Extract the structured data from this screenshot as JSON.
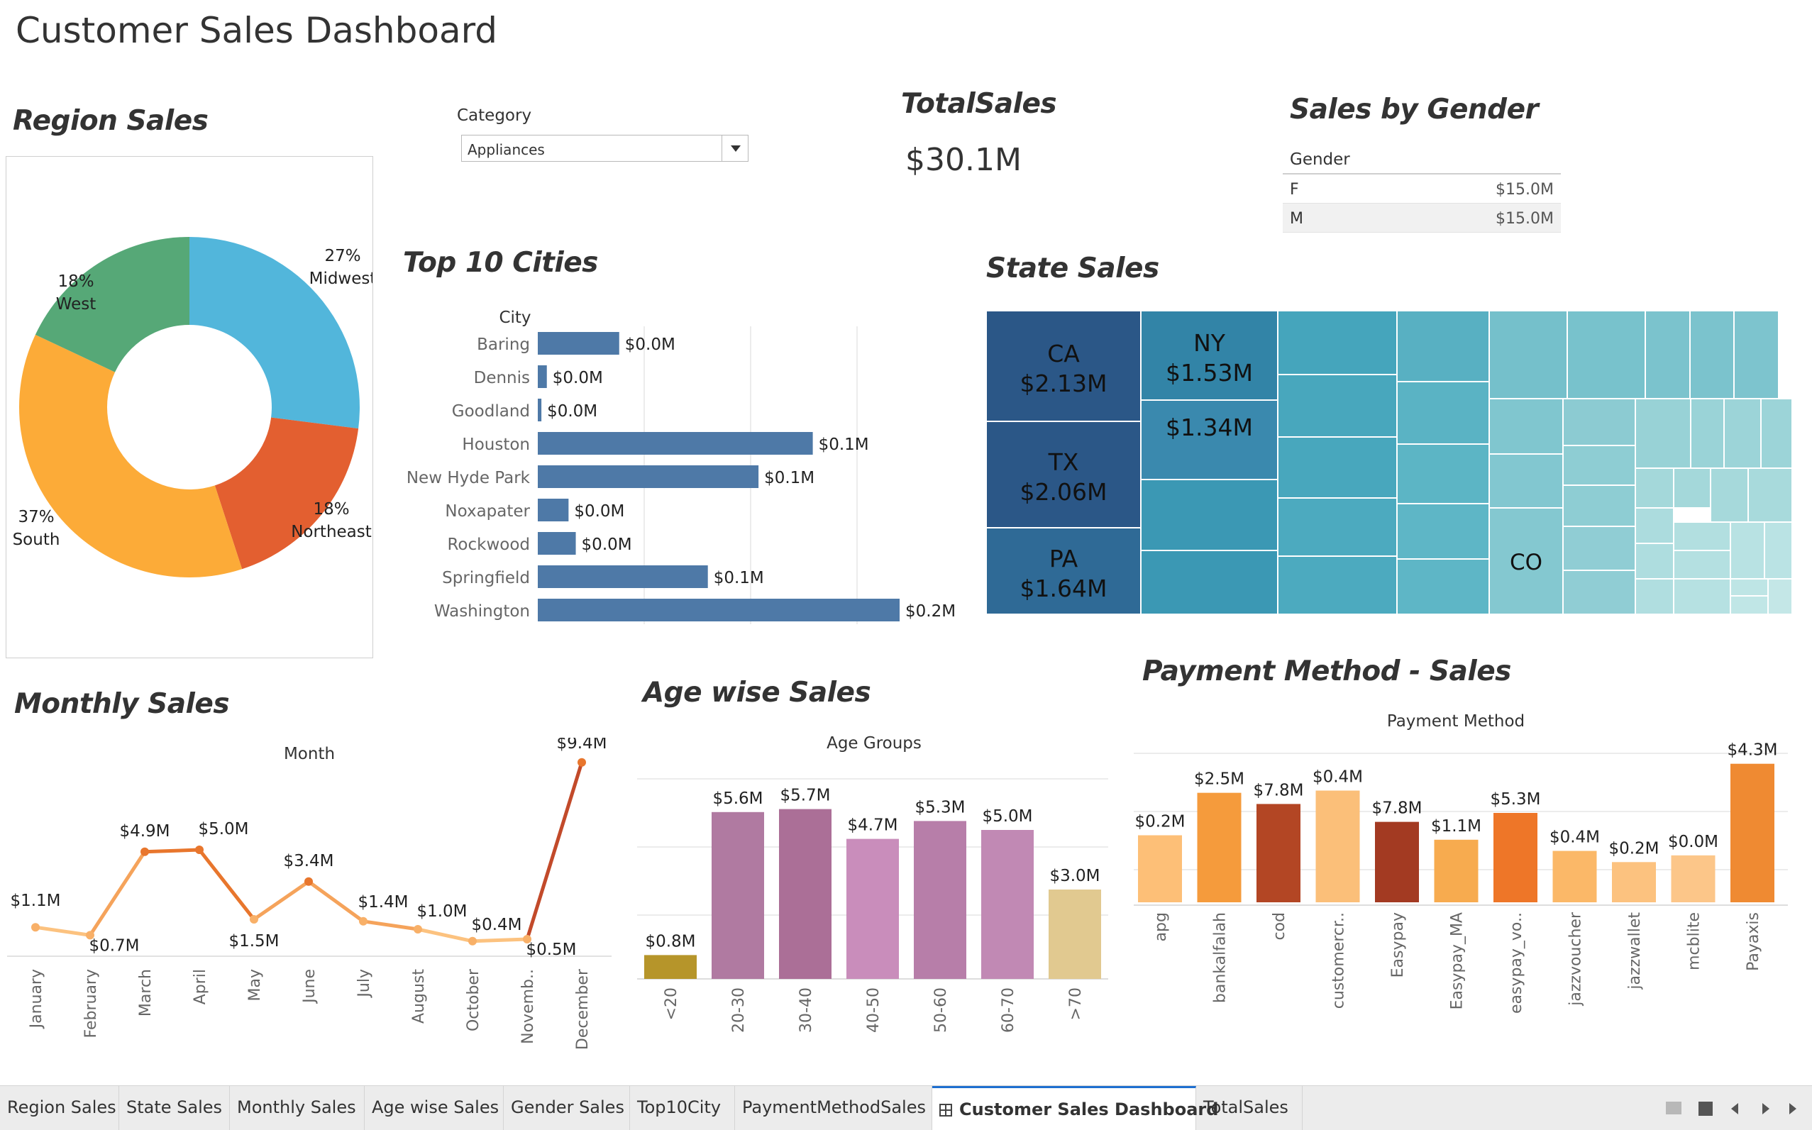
{
  "dashboard_title": "Customer Sales Dashboard",
  "region": {
    "title": "Region Sales",
    "slices": [
      {
        "name": "Midwest",
        "pct": "27%",
        "value": 27,
        "color": "#52b6db"
      },
      {
        "name": "Northeast",
        "pct": "18%",
        "value": 18,
        "color": "#e35f30"
      },
      {
        "name": "South",
        "pct": "37%",
        "value": 37,
        "color": "#fcab38"
      },
      {
        "name": "West",
        "pct": "18%",
        "value": 18,
        "color": "#56a877"
      }
    ]
  },
  "filter": {
    "label": "Category",
    "value": "Appliances"
  },
  "total_sales": {
    "title": "TotalSales",
    "value": "$30.1M"
  },
  "gender": {
    "title": "Sales by Gender",
    "header": "Gender",
    "rows": [
      {
        "key": "F",
        "value": "$15.0M"
      },
      {
        "key": "M",
        "value": "$15.0M"
      }
    ]
  },
  "cities": {
    "title": "Top 10 Cities",
    "header": "City",
    "rows": [
      {
        "name": "Baring",
        "value": 0.045,
        "label": "$0.0M"
      },
      {
        "name": "Dennis",
        "value": 0.005,
        "label": "$0.0M"
      },
      {
        "name": "Goodland",
        "value": 0.002,
        "label": "$0.0M"
      },
      {
        "name": "Houston",
        "value": 0.152,
        "label": "$0.1M"
      },
      {
        "name": "New Hyde Park",
        "value": 0.122,
        "label": "$0.1M"
      },
      {
        "name": "Noxapater",
        "value": 0.017,
        "label": "$0.0M"
      },
      {
        "name": "Rockwood",
        "value": 0.021,
        "label": "$0.0M"
      },
      {
        "name": "Springfield",
        "value": 0.094,
        "label": "$0.1M"
      },
      {
        "name": "Washington",
        "value": 0.2,
        "label": "$0.2M"
      }
    ]
  },
  "states": {
    "title": "State Sales",
    "labeled": [
      {
        "state": "CA",
        "label": "$2.13M"
      },
      {
        "state": "TX",
        "label": "$2.06M"
      },
      {
        "state": "PA",
        "label": "$1.64M"
      },
      {
        "state": "NY",
        "label": "$1.53M"
      },
      {
        "state": "",
        "label": "$1.34M"
      },
      {
        "state": "CO",
        "label": ""
      }
    ]
  },
  "monthly": {
    "title": "Monthly Sales",
    "axis_title": "Month",
    "months": [
      "January",
      "February",
      "March",
      "April",
      "May",
      "June",
      "July",
      "August",
      "October",
      "Novemb..",
      "December"
    ],
    "values": [
      1.1,
      0.7,
      4.9,
      5.0,
      1.5,
      3.4,
      1.4,
      1.0,
      0.4,
      0.5,
      9.4
    ],
    "labels": [
      "$1.1M",
      "$0.7M",
      "$4.9M",
      "$5.0M",
      "$1.5M",
      "$3.4M",
      "$1.4M",
      "$1.0M",
      "$0.4M",
      "$0.5M",
      "$9.4M"
    ]
  },
  "age": {
    "title": "Age wise Sales",
    "axis_title": "Age Groups",
    "groups": [
      "<20",
      "20-30",
      "30-40",
      "40-50",
      "50-60",
      "60-70",
      ">70"
    ],
    "values": [
      0.8,
      5.6,
      5.7,
      4.7,
      5.3,
      5.0,
      3.0
    ],
    "labels": [
      "$0.8M",
      "$5.6M",
      "$5.7M",
      "$4.7M",
      "$5.3M",
      "$5.0M",
      "$3.0M"
    ],
    "colors": [
      "#b6952a",
      "#b07aa1",
      "#ab6f97",
      "#c98dbb",
      "#b77ea9",
      "#c189b4",
      "#e1c990"
    ]
  },
  "payment": {
    "title": "Payment Method - Sales",
    "axis_title": "Payment Method",
    "methods": [
      "apg",
      "bankalfalah",
      "cod",
      "customercr..",
      "Easypay",
      "Easypay_MA",
      "easypay_vo..",
      "jazzvoucher",
      "jazzwallet",
      "mcblite",
      "Payaxis"
    ],
    "values": [
      1.5,
      2.45,
      2.2,
      2.5,
      1.8,
      1.4,
      2.0,
      1.15,
      0.9,
      1.05,
      3.1
    ],
    "labels": [
      "$0.2M",
      "$2.5M",
      "$7.8M",
      "$0.4M",
      "$7.8M",
      "$1.1M",
      "$5.3M",
      "$0.4M",
      "$0.2M",
      "$0.0M",
      "$4.3M"
    ],
    "colors": [
      "#fdbf77",
      "#f59b3c",
      "#b34624",
      "#fbbf79",
      "#a33a22",
      "#f7ab4f",
      "#ee7628",
      "#fbb868",
      "#fcc27f",
      "#fcc689",
      "#ef8a32"
    ]
  },
  "tabs": [
    {
      "label": "Region Sales",
      "active": false
    },
    {
      "label": "State Sales",
      "active": false
    },
    {
      "label": "Monthly Sales",
      "active": false
    },
    {
      "label": "Age wise Sales",
      "active": false
    },
    {
      "label": "Gender Sales",
      "active": false
    },
    {
      "label": "Top10City",
      "active": false
    },
    {
      "label": "PaymentMethodSales",
      "active": false
    },
    {
      "label": "Customer Sales Dashboard",
      "active": true
    },
    {
      "label": "TotalSales",
      "active": false
    }
  ]
}
